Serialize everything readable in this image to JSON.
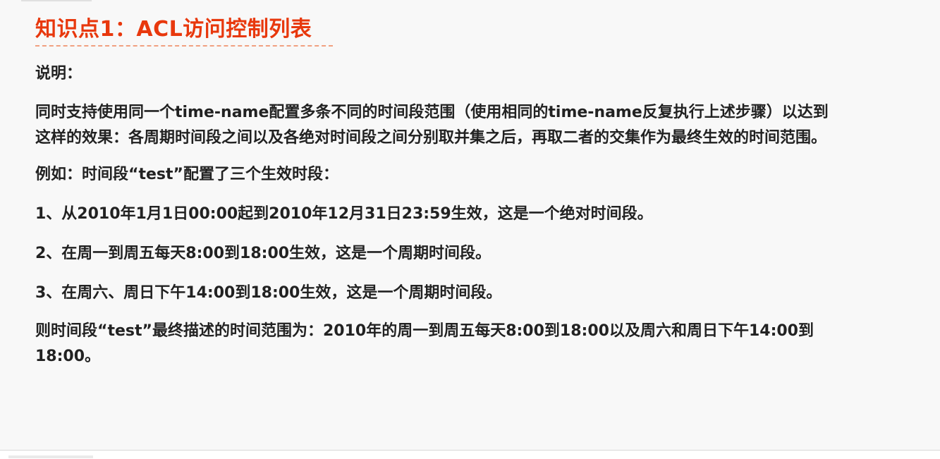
{
  "title": "知识点1：ACL访问控制列表",
  "description_label": "说明：",
  "intro": "同时支持使用同一个time-name配置多条不同的时间段范围（使用相同的time-name反复执行上述步骤）以达到这样的效果：各周期时间段之间以及各绝对时间段之间分别取并集之后，再取二者的交集作为最终生效的时间范围。",
  "example": "例如：时间段“test”配置了三个生效时段：",
  "steps": [
    "1、从2010年1月1日00:00起到2010年12月31日23:59生效，这是一个绝对时间段。",
    "2、在周一到周五每天8:00到18:00生效，这是一个周期时间段。",
    "3、在周六、周日下午14:00到18:00生效，这是一个周期时间段。"
  ],
  "conclusion": "则时间段“test”最终描述的时间范围为：2010年的周一到周五每天8:00到18:00以及周六和周日下午14:00到18:00。",
  "colors": {
    "title": "#e8380d",
    "text": "#222222",
    "background": "#f8f8f8"
  }
}
